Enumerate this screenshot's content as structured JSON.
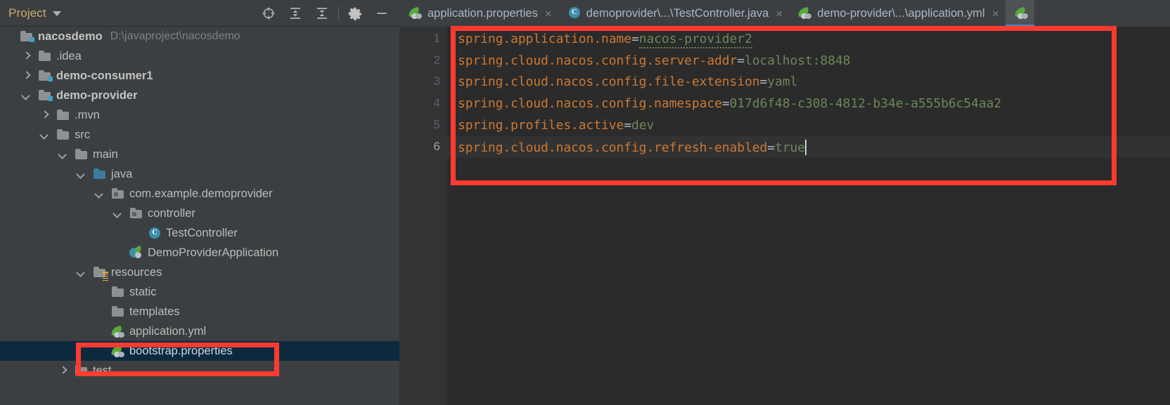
{
  "sidebar": {
    "title": "Project",
    "caret_icon": "chevron-down-icon",
    "toolbar": [
      {
        "name": "locate-icon",
        "label": "Select Opened File"
      },
      {
        "name": "expand-all-icon",
        "label": "Expand All"
      },
      {
        "name": "collapse-all-icon",
        "label": "Collapse All"
      },
      {
        "name": "gear-icon",
        "label": "Settings"
      },
      {
        "name": "minimize-icon",
        "label": "Hide"
      }
    ],
    "tree": [
      {
        "label": "nacosdemo",
        "detail": "D:\\javaproject\\nacosdemo",
        "icon": "module-folder-icon",
        "arrow": "",
        "indent": 0,
        "bold": true,
        "selected": false
      },
      {
        "label": ".idea",
        "detail": "",
        "icon": "folder-icon",
        "arrow": "right",
        "indent": 1,
        "bold": false,
        "selected": false
      },
      {
        "label": "demo-consumer1",
        "detail": "",
        "icon": "module-folder-icon",
        "arrow": "right",
        "indent": 1,
        "bold": true,
        "selected": false
      },
      {
        "label": "demo-provider",
        "detail": "",
        "icon": "module-folder-icon",
        "arrow": "down",
        "indent": 1,
        "bold": true,
        "selected": false
      },
      {
        "label": ".mvn",
        "detail": "",
        "icon": "folder-icon",
        "arrow": "right",
        "indent": 2,
        "bold": false,
        "selected": false
      },
      {
        "label": "src",
        "detail": "",
        "icon": "folder-icon",
        "arrow": "down",
        "indent": 2,
        "bold": false,
        "selected": false
      },
      {
        "label": "main",
        "detail": "",
        "icon": "folder-icon",
        "arrow": "down",
        "indent": 3,
        "bold": false,
        "selected": false
      },
      {
        "label": "java",
        "detail": "",
        "icon": "source-folder-icon",
        "arrow": "down",
        "indent": 4,
        "bold": false,
        "selected": false
      },
      {
        "label": "com.example.demoprovider",
        "detail": "",
        "icon": "package-icon",
        "arrow": "down",
        "indent": 5,
        "bold": false,
        "selected": false
      },
      {
        "label": "controller",
        "detail": "",
        "icon": "package-icon",
        "arrow": "down",
        "indent": 6,
        "bold": false,
        "selected": false
      },
      {
        "label": "TestController",
        "detail": "",
        "icon": "java-class-icon",
        "arrow": "",
        "indent": 7,
        "bold": false,
        "selected": false
      },
      {
        "label": "DemoProviderApplication",
        "detail": "",
        "icon": "spring-boot-class-icon",
        "arrow": "",
        "indent": 6,
        "bold": false,
        "selected": false
      },
      {
        "label": "resources",
        "detail": "",
        "icon": "resources-folder-icon",
        "arrow": "down",
        "indent": 4,
        "bold": false,
        "selected": false
      },
      {
        "label": "static",
        "detail": "",
        "icon": "folder-icon",
        "arrow": "",
        "indent": 5,
        "bold": false,
        "selected": false
      },
      {
        "label": "templates",
        "detail": "",
        "icon": "folder-icon",
        "arrow": "",
        "indent": 5,
        "bold": false,
        "selected": false
      },
      {
        "label": "application.yml",
        "detail": "",
        "icon": "spring-config-icon",
        "arrow": "",
        "indent": 5,
        "bold": false,
        "selected": false
      },
      {
        "label": "bootstrap.properties",
        "detail": "",
        "icon": "spring-config-icon",
        "arrow": "",
        "indent": 5,
        "bold": false,
        "selected": true
      },
      {
        "label": "test",
        "detail": "",
        "icon": "folder-icon",
        "arrow": "right",
        "indent": 3,
        "bold": false,
        "selected": false
      }
    ]
  },
  "editor": {
    "tabs": [
      {
        "label": "application.properties",
        "icon": "spring-config-icon",
        "active": false,
        "close": "×"
      },
      {
        "label": "demoprovider\\...\\TestController.java",
        "icon": "java-class-icon",
        "active": false,
        "close": "×"
      },
      {
        "label": "demo-provider\\...\\application.yml",
        "icon": "spring-config-icon",
        "active": false,
        "close": "×"
      },
      {
        "label": "",
        "icon": "spring-config-icon",
        "active": true,
        "close": ""
      }
    ],
    "line_numbers": [
      "1",
      "2",
      "3",
      "4",
      "5",
      "6"
    ],
    "caret_line": 6,
    "lines": [
      {
        "key": "spring.application.name",
        "eq": "=",
        "value": "nacos-provider2",
        "value_warning": true
      },
      {
        "key": "spring.cloud.nacos.config.server-addr",
        "eq": "=",
        "value": "localhost:8848",
        "value_warning": false
      },
      {
        "key": "spring.cloud.nacos.config.file-extension",
        "eq": "=",
        "value": "yaml",
        "value_warning": false
      },
      {
        "key": "spring.cloud.nacos.config.namespace",
        "eq": "=",
        "value": "017d6f48-c308-4812-b34e-a555b6c54aa2",
        "value_warning": false
      },
      {
        "key": "spring.profiles.active",
        "eq": "=",
        "value": "dev",
        "value_warning": false
      },
      {
        "key": "spring.cloud.nacos.config.refresh-enabled",
        "eq": "=",
        "value": "true",
        "value_warning": false
      }
    ]
  },
  "annotations": [
    {
      "name": "editor-content-highlight",
      "color": "#ff3b30"
    },
    {
      "name": "bootstrap-properties-highlight",
      "color": "#ff3b30"
    }
  ]
}
